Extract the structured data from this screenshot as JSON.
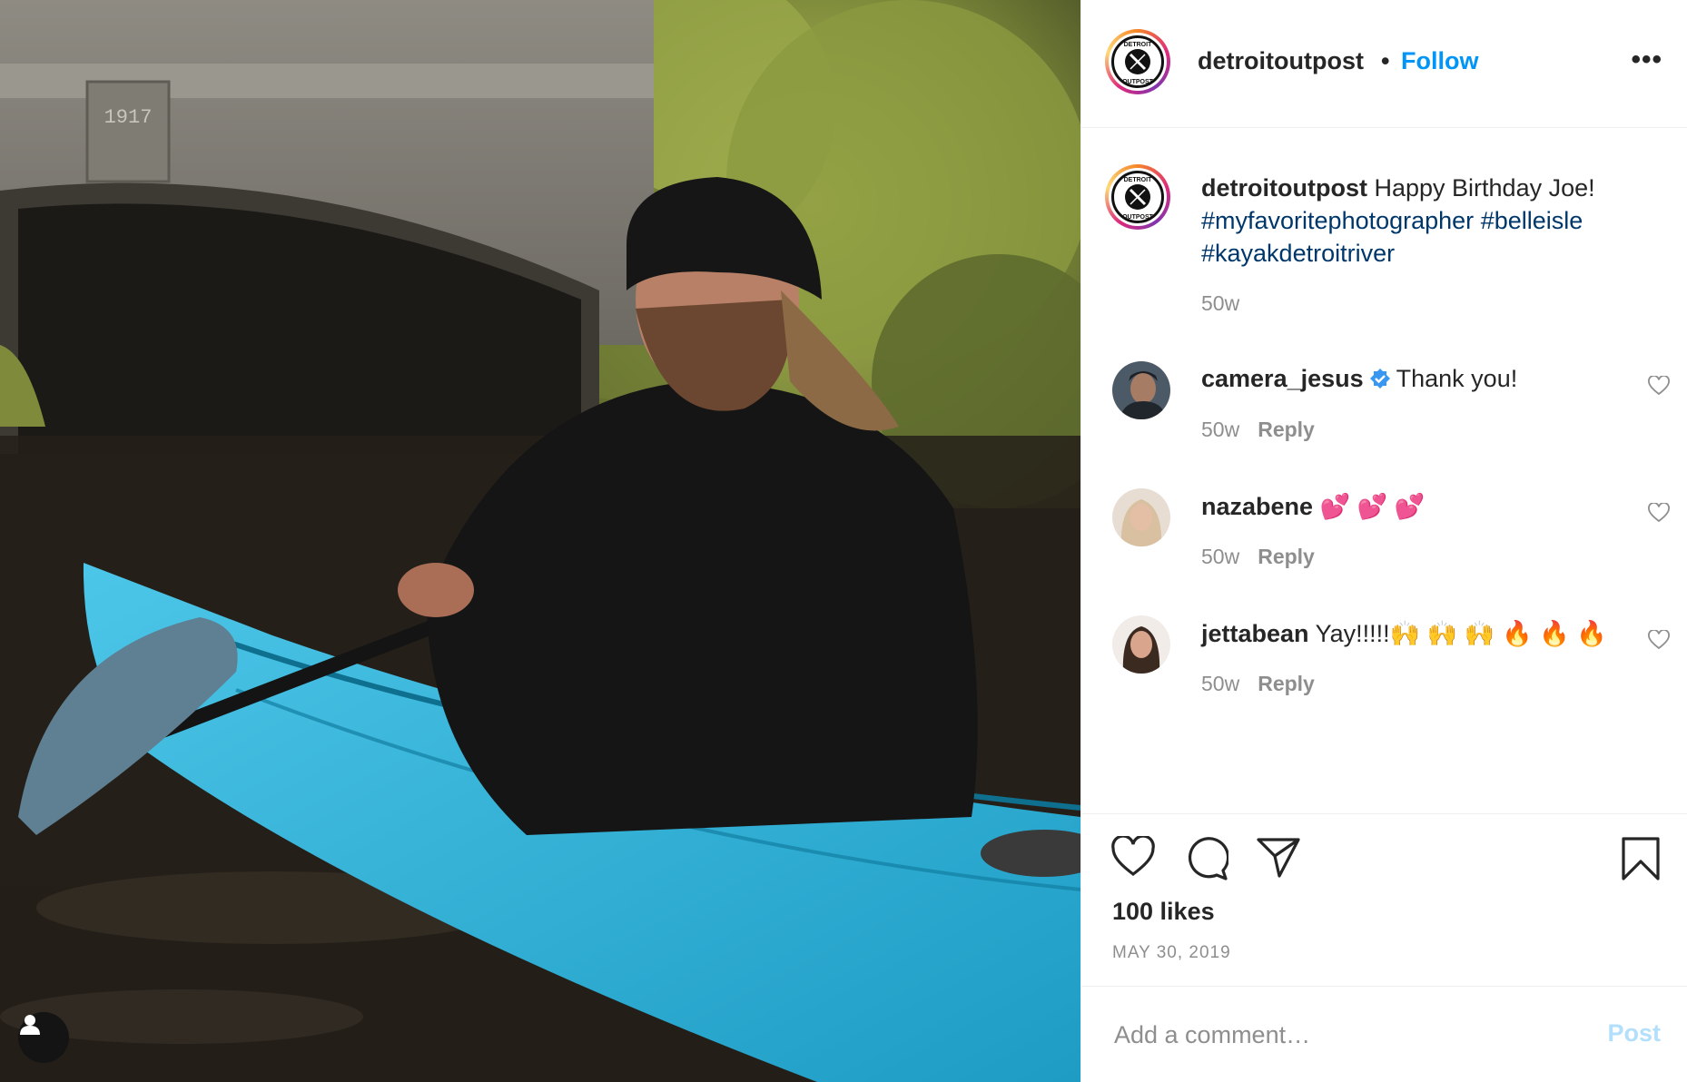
{
  "post": {
    "author": "detroitoutpost",
    "follow_label": "Follow",
    "separator": "•",
    "more_label": "•••",
    "logo_text_top": "DETROIT",
    "logo_text_bottom": "OUTPOST",
    "photo_date_carving": "1917"
  },
  "caption": {
    "username": "detroitoutpost",
    "text": "Happy Birthday Joe!",
    "hashtags": [
      "#myfavoritephotographer",
      "#belleisle",
      "#kayakdetroitriver"
    ],
    "time": "50w"
  },
  "comments": [
    {
      "username": "camera_jesus",
      "verified": true,
      "text": "Thank you!",
      "time": "50w",
      "reply_label": "Reply"
    },
    {
      "username": "nazabene",
      "verified": false,
      "text": "💕 💕 💕",
      "time": "50w",
      "reply_label": "Reply"
    },
    {
      "username": "jettabean",
      "verified": false,
      "text": "Yay!!!!!🙌 🙌 🙌 🔥 🔥 🔥",
      "time": "50w",
      "reply_label": "Reply"
    }
  ],
  "actions": {
    "icons": [
      "heart-icon",
      "comment-icon",
      "share-icon",
      "bookmark-icon"
    ],
    "likes": "100 likes",
    "date": "MAY 30, 2019"
  },
  "add_comment": {
    "placeholder": "Add a comment…",
    "post_label": "Post"
  },
  "colors": {
    "link": "#0095f6",
    "hashtag": "#00376b",
    "muted": "#8e8e8e",
    "post_disabled": "#b2dffc",
    "kayak": "#2bb3d8"
  }
}
